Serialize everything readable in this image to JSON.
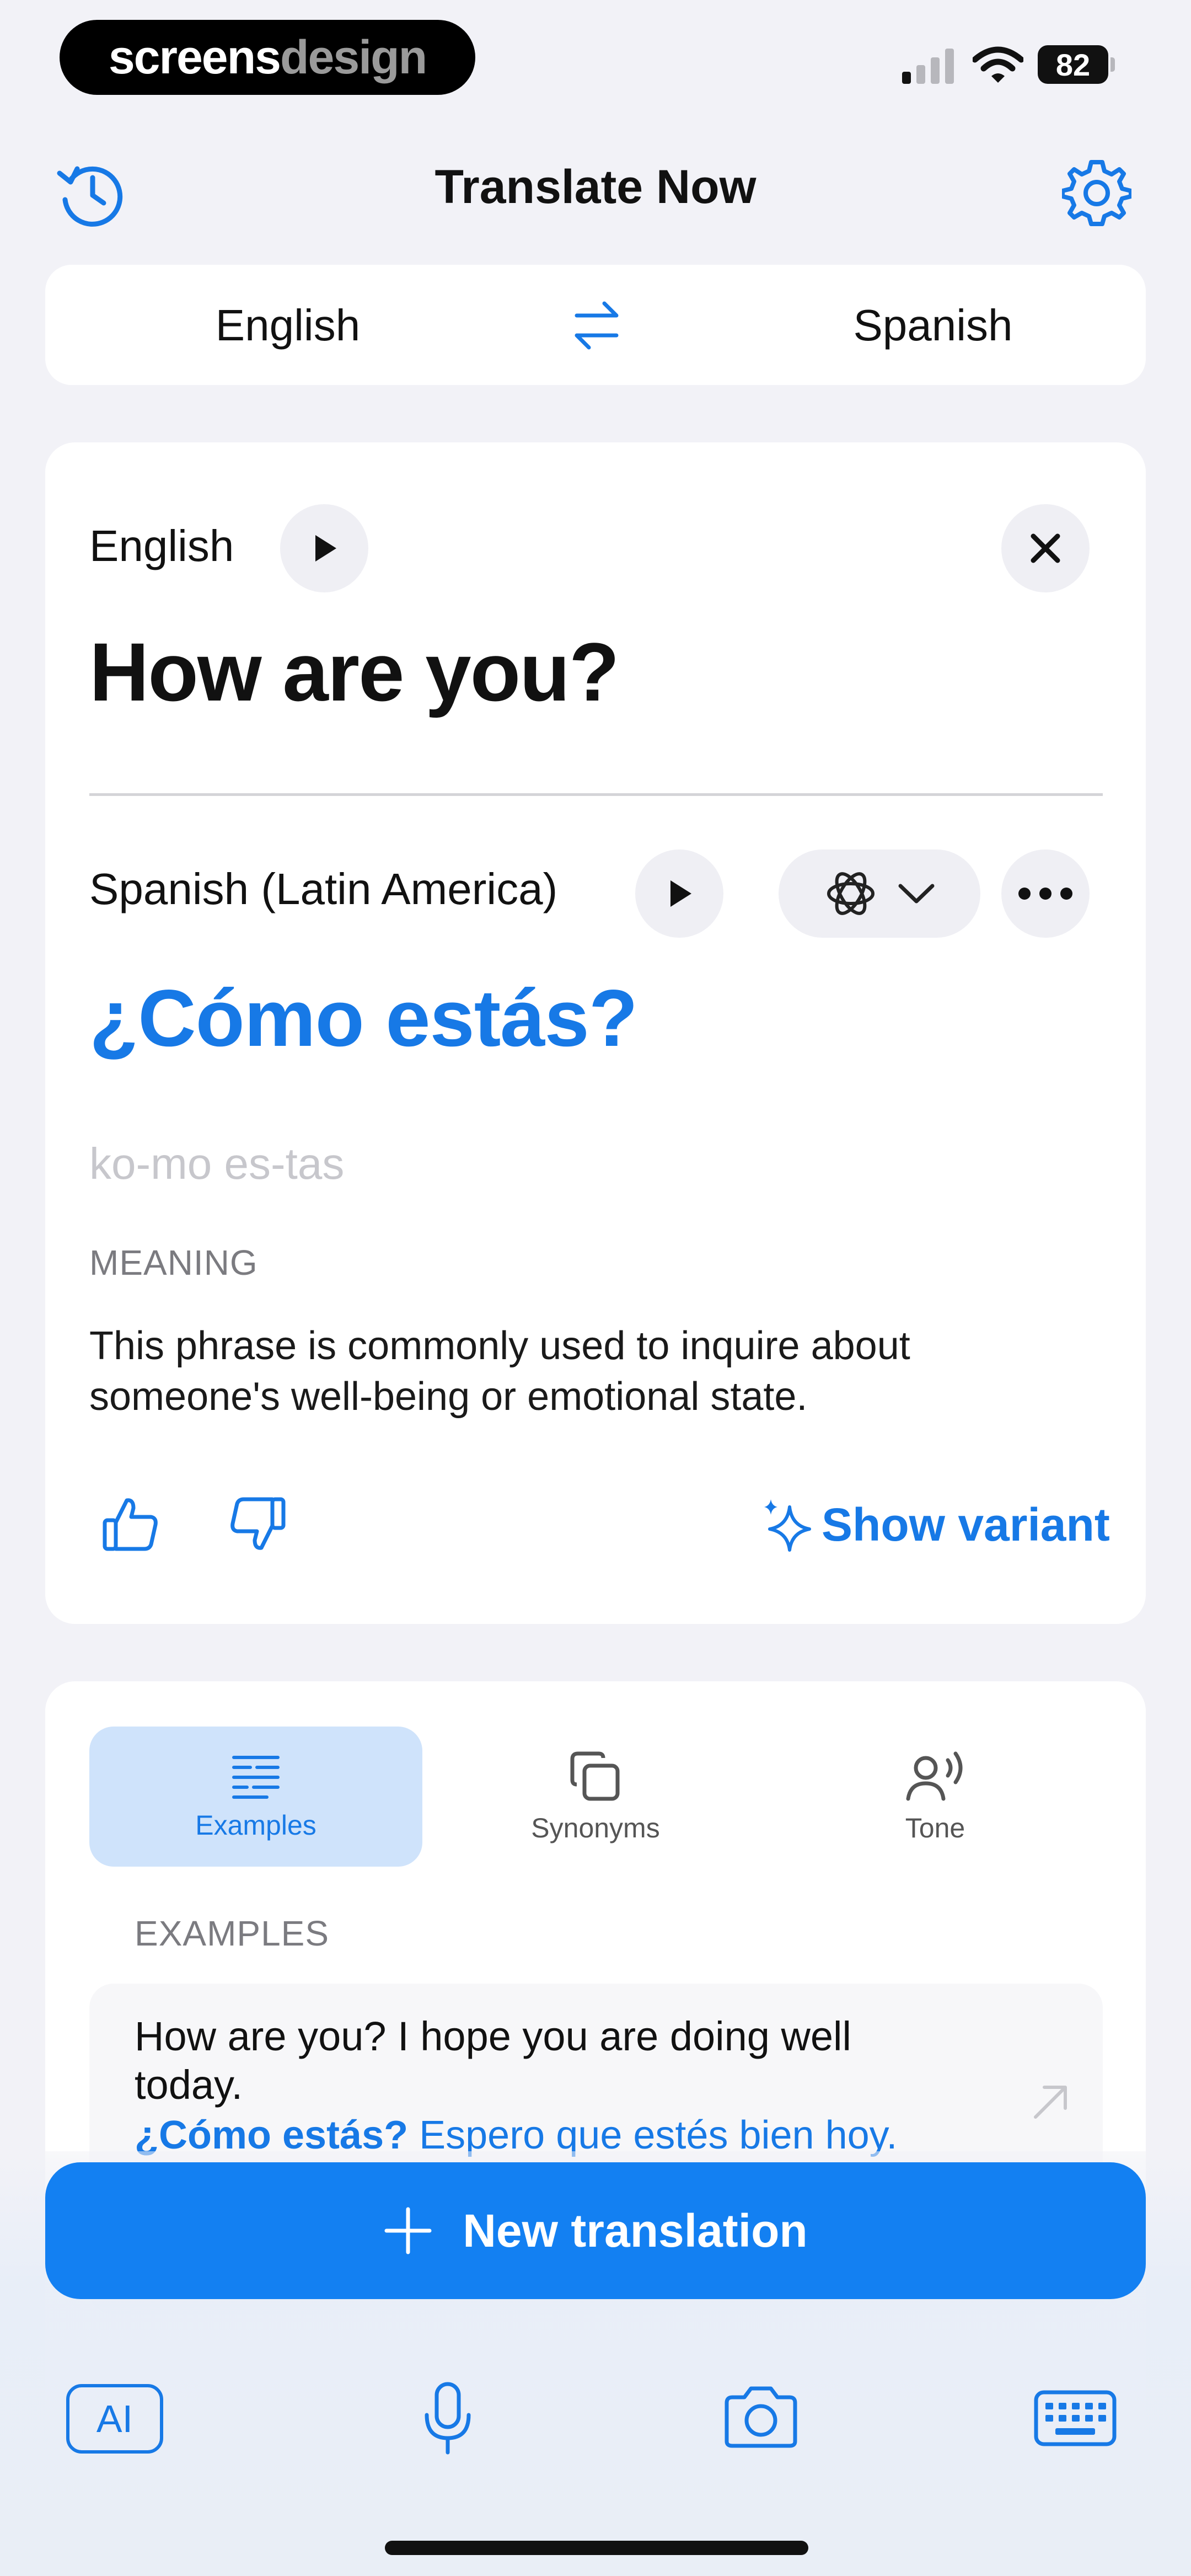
{
  "status": {
    "brand_part1": "screens",
    "brand_part2": "design",
    "battery": "82"
  },
  "header": {
    "title": "Translate Now"
  },
  "language_bar": {
    "source": "English",
    "target": "Spanish"
  },
  "source": {
    "language": "English",
    "text": "How are you?"
  },
  "translation": {
    "language": "Spanish (Latin America)",
    "text": "¿Cómo estás?",
    "pronunciation": "ko-mo es-tas",
    "meaning_heading": "MEANING",
    "meaning_text": "This phrase is commonly used to inquire about someone's well-being or emotional state.",
    "show_variant": "Show variant"
  },
  "tabs": [
    {
      "label": "Examples",
      "icon": "list-lines-icon",
      "active": true
    },
    {
      "label": "Synonyms",
      "icon": "copy-squares-icon",
      "active": false
    },
    {
      "label": "Tone",
      "icon": "speaking-person-icon",
      "active": false
    }
  ],
  "examples": {
    "heading": "EXAMPLES",
    "items": [
      {
        "source": "How are you? I hope you are doing well today.",
        "target_highlight": "¿Cómo estás?",
        "target_rest": " Espero que estés bien hoy."
      }
    ]
  },
  "new_translation_button": "New translation",
  "bottom_bar": {
    "ai_label": "AI"
  },
  "colors": {
    "accent": "#1380f2",
    "background": "#f2f2f7",
    "card": "#ffffff",
    "tab_active": "#cfe3fb"
  }
}
